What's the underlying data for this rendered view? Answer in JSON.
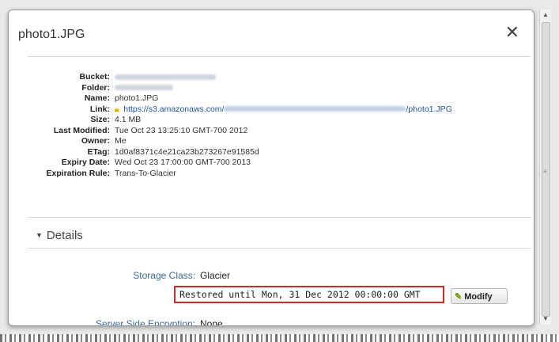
{
  "dialog": {
    "title": "photo1.JPG",
    "close_symbol": "✕"
  },
  "meta": {
    "bucket_label": "Bucket:",
    "folder_label": "Folder:",
    "name_label": "Name:",
    "name_value": "photo1.JPG",
    "link_label": "Link:",
    "link_prefix": "https://s3.amazonaws.com/",
    "link_suffix": "/photo1.JPG",
    "size_label": "Size:",
    "size_value": "4.1 MB",
    "last_modified_label": "Last Modified:",
    "last_modified_value": "Tue Oct 23 13:25:10 GMT-700 2012",
    "owner_label": "Owner:",
    "owner_value": "Me",
    "etag_label": "ETag:",
    "etag_value": "1d0af8371c4e21ca23b273267e91585d",
    "expiry_date_label": "Expiry Date:",
    "expiry_date_value": "Wed Oct 23 17:00:00 GMT-700 2013",
    "expiration_rule_label": "Expiration Rule:",
    "expiration_rule_value": "Trans-To-Glacier"
  },
  "details": {
    "section_label": "Details",
    "storage_class_label": "Storage Class:",
    "storage_class_value": "Glacier",
    "restored_text": "Restored until Mon, 31 Dec 2012 00:00:00 GMT",
    "modify_label": "Modify",
    "sse_label": "Server Side Encryption:",
    "sse_value": "None"
  },
  "icons": {
    "close": "close-icon",
    "lock": "lock-icon",
    "modify": "edit-icon",
    "collapse": "triangle-down-icon"
  },
  "colors": {
    "highlight_border": "#cc2b2b",
    "field_label": "#3d6a9e",
    "link": "#1e56a0"
  }
}
